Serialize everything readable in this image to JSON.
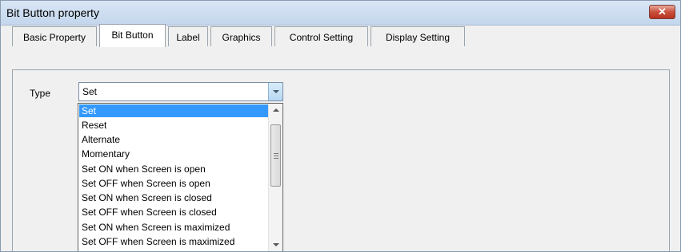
{
  "window": {
    "title": "Bit Button property",
    "close_glyph": "✕"
  },
  "tabs": [
    {
      "label": "Basic Property"
    },
    {
      "label": "Bit Button"
    },
    {
      "label": "Label"
    },
    {
      "label": "Graphics"
    },
    {
      "label": "Control Setting"
    },
    {
      "label": "Display Setting"
    }
  ],
  "active_tab": "Bit Button",
  "type_field": {
    "label": "Type",
    "value": "Set",
    "options": [
      "Set",
      "Reset",
      "Alternate",
      "Momentary",
      "Set ON when Screen is open",
      "Set OFF when Screen is open",
      "Set ON when Screen is closed",
      "Set OFF when Screen is closed",
      "Set ON when Screen is maximized",
      "Set OFF when Screen is maximized"
    ]
  },
  "colors": {
    "selection": "#3399ff",
    "titlebar": "#c9dbef",
    "close": "#c9503d"
  }
}
